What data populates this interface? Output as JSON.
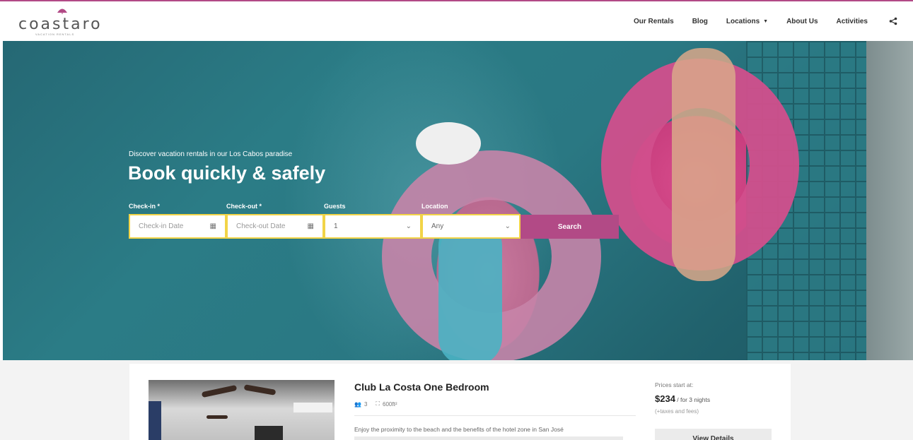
{
  "brand": {
    "logo_text": "coastaro",
    "logo_sub": "VACATION RENTALS",
    "accent_color": "#b24a86",
    "field_border_color": "#f2d447"
  },
  "nav": {
    "items": [
      {
        "label": "Our Rentals"
      },
      {
        "label": "Blog"
      },
      {
        "label": "Locations",
        "has_dropdown": true
      },
      {
        "label": "About Us"
      },
      {
        "label": "Activities"
      }
    ],
    "share_icon": "share-icon"
  },
  "hero": {
    "subtitle": "Discover vacation rentals in our Los Cabos paradise",
    "title": "Book quickly & safely",
    "form": {
      "checkin_label": "Check-in *",
      "checkin_placeholder": "Check-in Date",
      "checkout_label": "Check-out *",
      "checkout_placeholder": "Check-out Date",
      "guests_label": "Guests",
      "guests_value": "1",
      "location_label": "Location",
      "location_value": "Any",
      "search_label": "Search"
    }
  },
  "listing": {
    "title": "Club La Costa One Bedroom",
    "guests": "3",
    "area": "600ft²",
    "description": "Enjoy the proximity to the beach and the benefits of the hotel zone in San José",
    "price_label": "Prices start at:",
    "price": "$234",
    "price_period": "/ for 3 nights",
    "price_note": "(+taxes and fees)",
    "view_details_label": "View Details"
  }
}
